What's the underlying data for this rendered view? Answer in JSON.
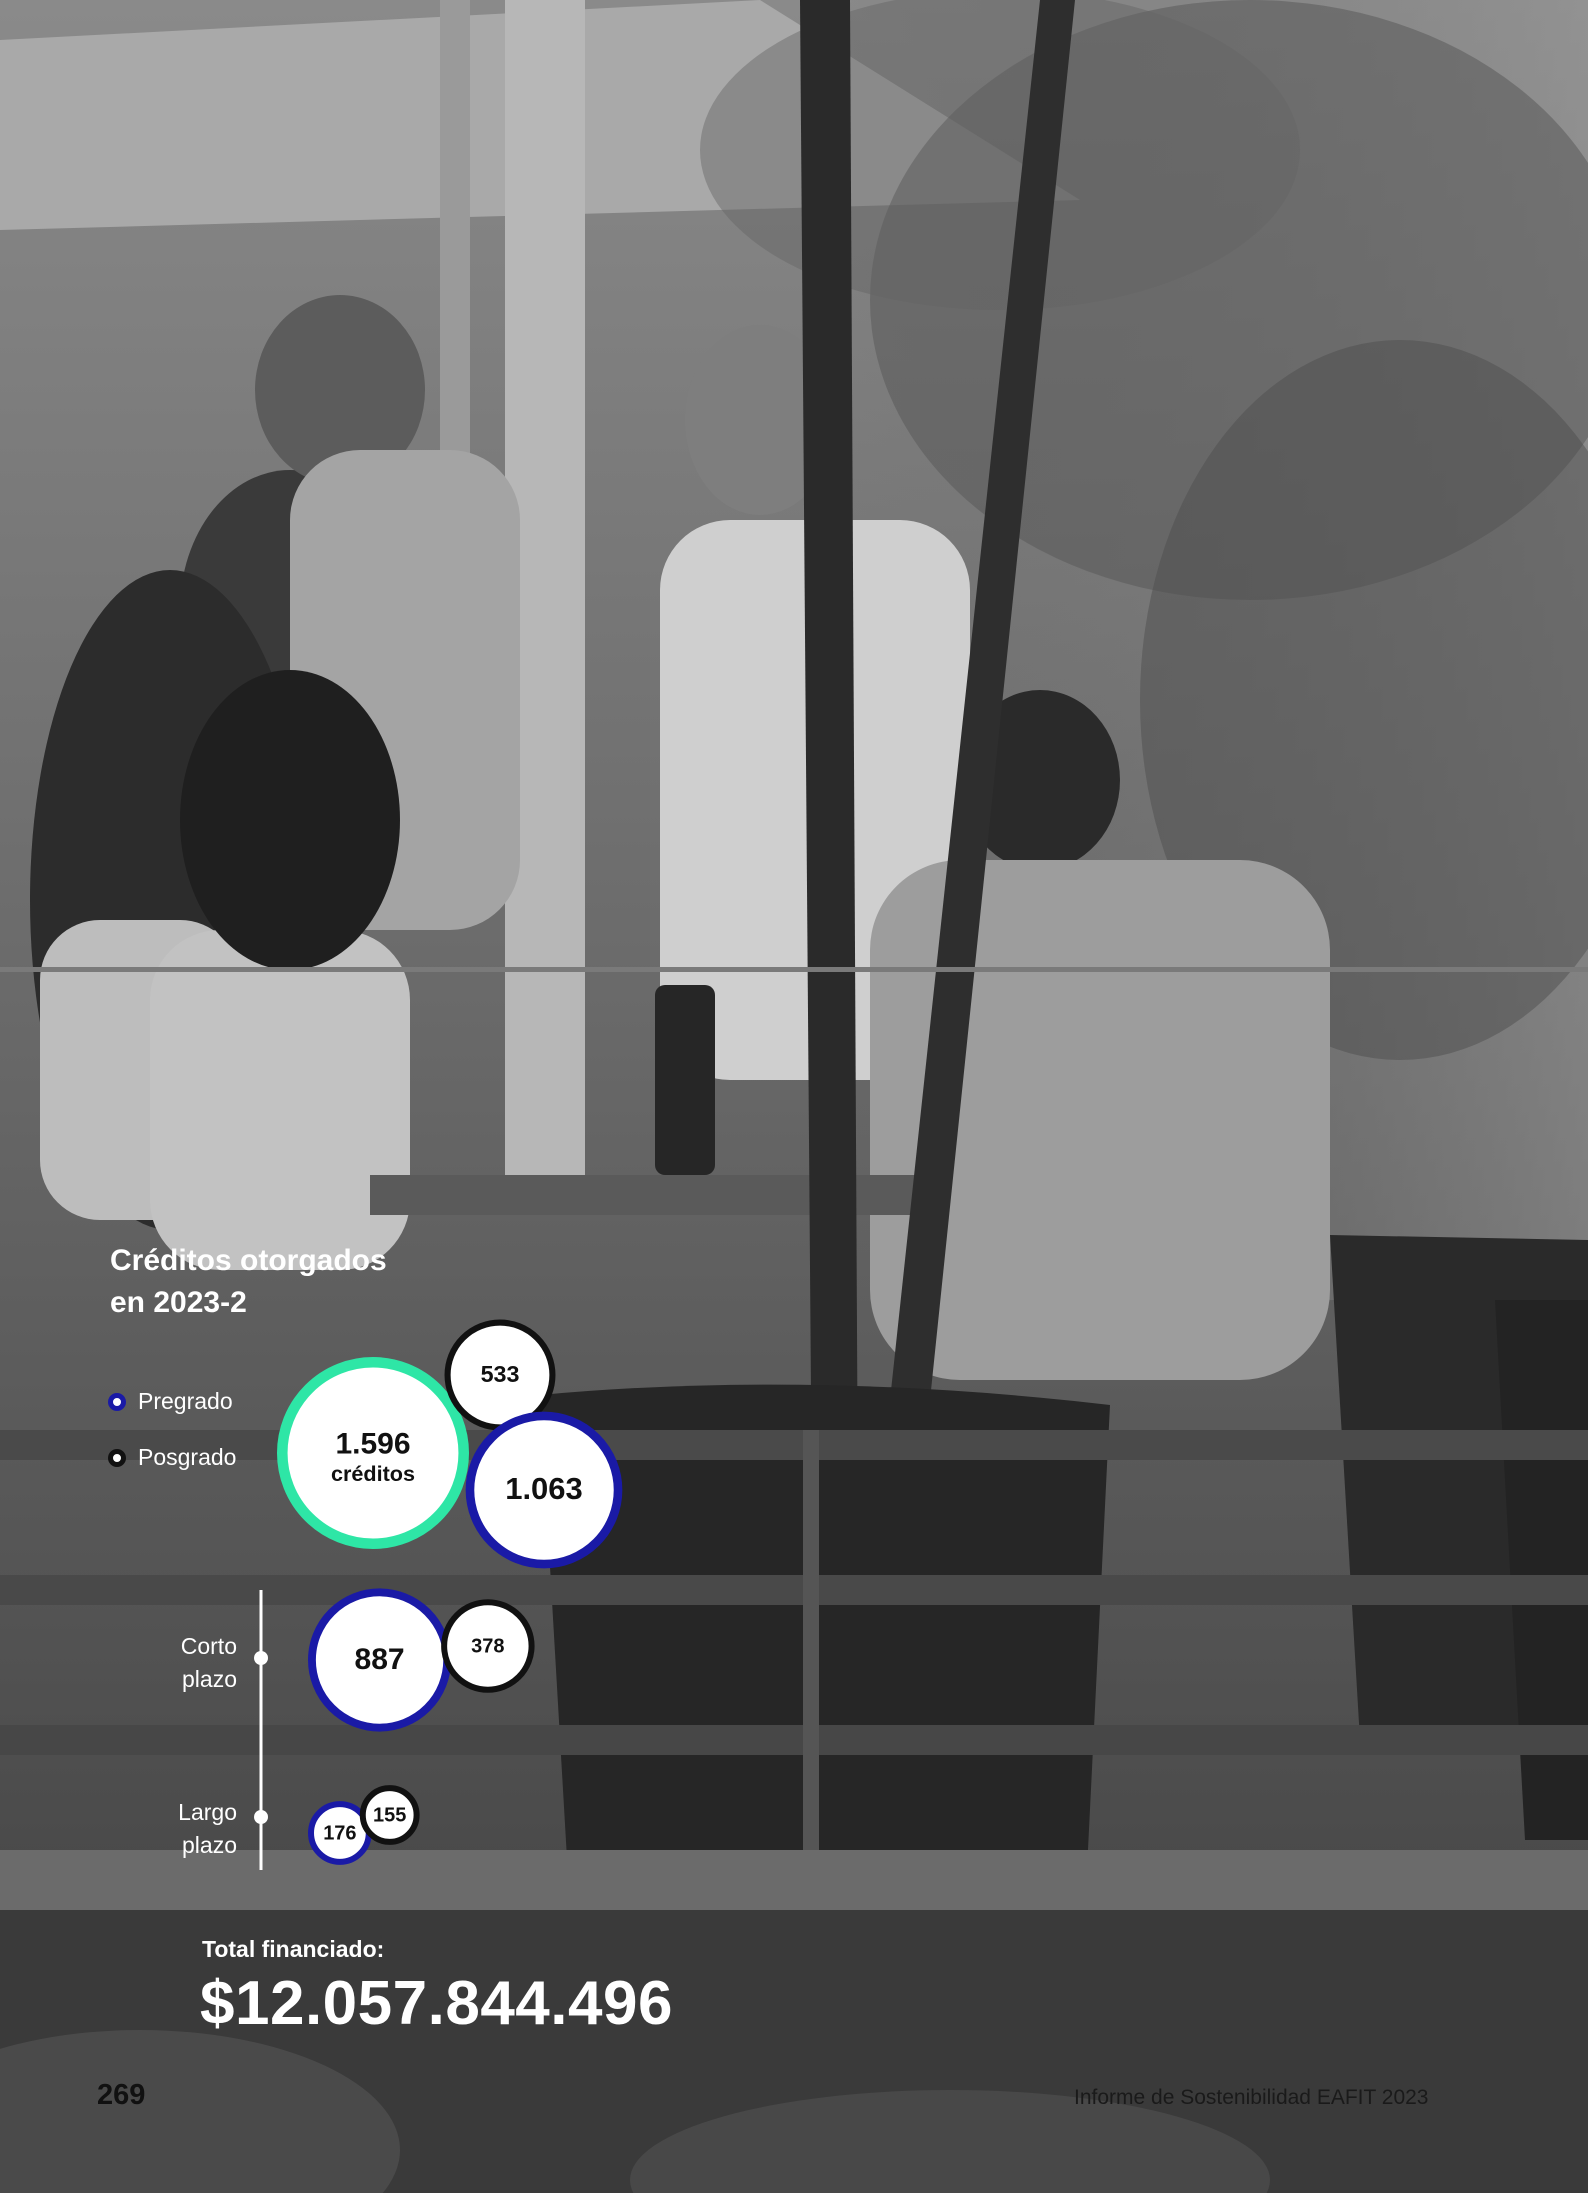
{
  "chart_data": {
    "type": "bubble",
    "title": "Créditos otorgados en 2023-2",
    "title_lines": [
      "Créditos otorgados",
      "en 2023-2"
    ],
    "colors": {
      "pregrado": "#1a1aa6",
      "posgrado": "#111111",
      "total": "#2ee6a6"
    },
    "legend": [
      {
        "key": "pregrado",
        "label": "Pregrado"
      },
      {
        "key": "posgrado",
        "label": "Posgrado"
      }
    ],
    "total": {
      "value": 1596,
      "label": "1.596",
      "sublabel": "créditos"
    },
    "by_level": [
      {
        "key": "posgrado",
        "value": 533,
        "label": "533"
      },
      {
        "key": "pregrado",
        "value": 1063,
        "label": "1.063"
      }
    ],
    "by_term": [
      {
        "label_lines": [
          "Corto",
          "plazo"
        ],
        "values": [
          {
            "key": "pregrado",
            "value": 887,
            "label": "887"
          },
          {
            "key": "posgrado",
            "value": 378,
            "label": "378"
          }
        ]
      },
      {
        "label_lines": [
          "Largo",
          "plazo"
        ],
        "values": [
          {
            "key": "pregrado",
            "value": 176,
            "label": "176"
          },
          {
            "key": "posgrado",
            "value": 155,
            "label": "155"
          }
        ]
      }
    ]
  },
  "summary": {
    "total_label": "Total financiado:",
    "total_value": "$12.057.844.496"
  },
  "footer": {
    "page_number": "269",
    "report_title": "Informe de Sostenibilidad EAFIT 2023"
  }
}
